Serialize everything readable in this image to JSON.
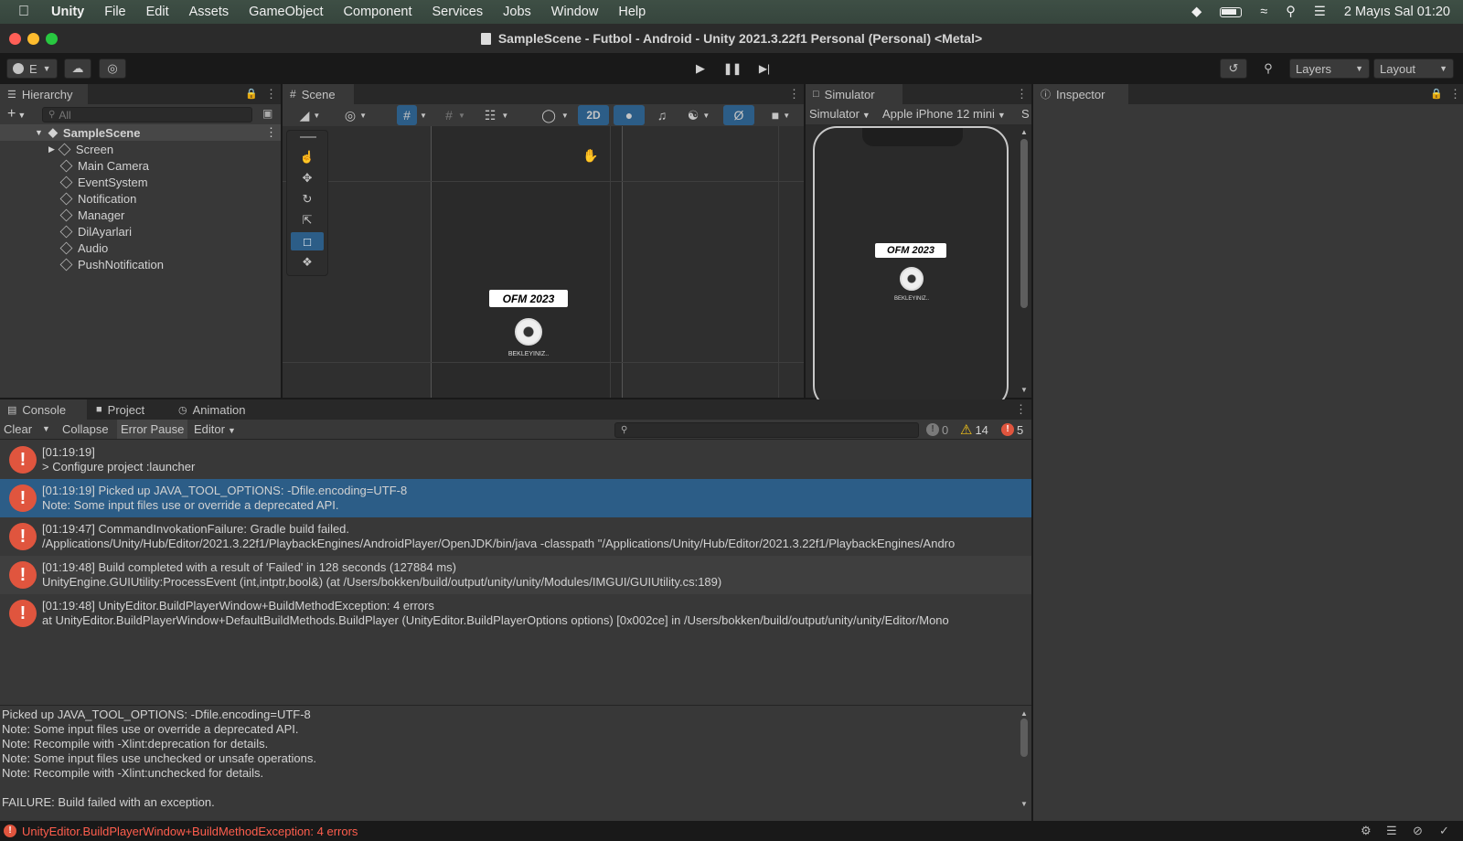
{
  "menubar": {
    "apple_icon": "",
    "app_name": "Unity",
    "items": [
      "File",
      "Edit",
      "Assets",
      "GameObject",
      "Component",
      "Services",
      "Jobs",
      "Window",
      "Help"
    ],
    "datetime": "2 Mayıs Sal  01:20"
  },
  "window": {
    "title": "SampleScene - Futbol - Android - Unity 2021.3.22f1 Personal (Personal) <Metal>"
  },
  "toolbar": {
    "account_label": "E",
    "layers_label": "Layers",
    "layout_label": "Layout"
  },
  "hierarchy": {
    "tab_label": "Hierarchy",
    "search_placeholder": "All",
    "scene_name": "SampleScene",
    "items": [
      "Screen",
      "Main Camera",
      "EventSystem",
      "Notification",
      "Manager",
      "DilAyarlari",
      "Audio",
      "PushNotification"
    ]
  },
  "scene": {
    "tab_label": "Scene",
    "mode_2d": "2D",
    "logo_text": "OFM 2023",
    "waiting_text": "BEKLEYINIZ.."
  },
  "simulator": {
    "tab_label": "Simulator",
    "mode": "Simulator",
    "device": "Apple iPhone 12 mini",
    "extra": "S"
  },
  "inspector": {
    "tab_label": "Inspector"
  },
  "bottom_tabs": {
    "console": "Console",
    "project": "Project",
    "animation": "Animation"
  },
  "console": {
    "clear": "Clear",
    "collapse": "Collapse",
    "error_pause": "Error Pause",
    "editor": "Editor",
    "count_info": "0",
    "count_warn": "14",
    "count_error": "5",
    "entries": [
      {
        "line1": "[01:19:19]",
        "line2": "> Configure project :launcher"
      },
      {
        "line1": "[01:19:19] Picked up JAVA_TOOL_OPTIONS: -Dfile.encoding=UTF-8",
        "line2": "Note: Some input files use or override a deprecated API."
      },
      {
        "line1": "[01:19:47] CommandInvokationFailure: Gradle build failed.",
        "line2": "/Applications/Unity/Hub/Editor/2021.3.22f1/PlaybackEngines/AndroidPlayer/OpenJDK/bin/java -classpath \"/Applications/Unity/Hub/Editor/2021.3.22f1/PlaybackEngines/Andro"
      },
      {
        "line1": "[01:19:48] Build completed with a result of 'Failed' in 128 seconds (127884 ms)",
        "line2": "UnityEngine.GUIUtility:ProcessEvent (int,intptr,bool&) (at /Users/bokken/build/output/unity/unity/Modules/IMGUI/GUIUtility.cs:189)"
      },
      {
        "line1": "[01:19:48] UnityEditor.BuildPlayerWindow+BuildMethodException: 4 errors",
        "line2": "  at UnityEditor.BuildPlayerWindow+DefaultBuildMethods.BuildPlayer (UnityEditor.BuildPlayerOptions options) [0x002ce] in /Users/bokken/build/output/unity/unity/Editor/Mono"
      }
    ],
    "detail_lines": [
      "Picked up JAVA_TOOL_OPTIONS: -Dfile.encoding=UTF-8",
      "Note: Some input files use or override a deprecated API.",
      "Note: Recompile with -Xlint:deprecation for details.",
      "Note: Some input files use unchecked or unsafe operations.",
      "Note: Recompile with -Xlint:unchecked for details.",
      "",
      "FAILURE: Build failed with an exception."
    ]
  },
  "statusbar": {
    "message": "UnityEditor.BuildPlayerWindow+BuildMethodException: 4 errors"
  },
  "colors": {
    "selection": "#2c5d87",
    "error": "#e0553e",
    "warning": "#f5c518",
    "status_error_text": "#ff5e4d"
  }
}
